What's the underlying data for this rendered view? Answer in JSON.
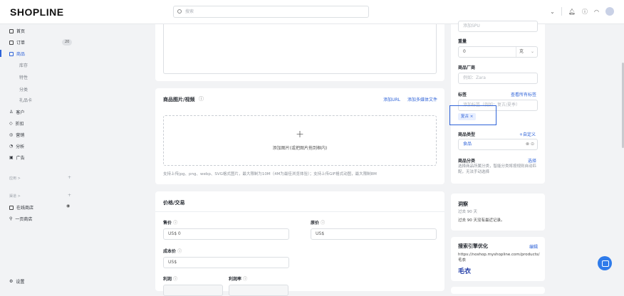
{
  "brand": {
    "logo": "SHOPLINE"
  },
  "search": {
    "placeholder": "搜索"
  },
  "sidebar": {
    "items": [
      {
        "label": "首页"
      },
      {
        "label": "订单",
        "badge": "20"
      },
      {
        "label": "商品"
      },
      {
        "label": "客户"
      },
      {
        "label": "折扣"
      },
      {
        "label": "营销"
      },
      {
        "label": "分析"
      },
      {
        "label": "广告"
      }
    ],
    "subitems": [
      "库存",
      "特性",
      "分类",
      "礼品卡"
    ],
    "apps_label": "应用 >",
    "channels_label": "渠道 >",
    "channels": [
      {
        "label": "在线商店"
      },
      {
        "label": "一页商店"
      }
    ],
    "settings_label": "设置"
  },
  "media": {
    "title": "商品图片/视频",
    "add_url": "添加URL",
    "add_multi": "添加多媒体文件",
    "plus": "+",
    "drop_text": "添加图片(或把图片拖到框内)",
    "hint": "支持上传jpg、png、webp、SVG格式图片，最大限制为10M（4M为最佳浏览体验）；支持上传GIF格式动图，最大限制8M"
  },
  "pricing": {
    "title": "价格/交易",
    "price_label": "售价",
    "price_value": "US$  0",
    "compare_label": "原价",
    "compare_value": "US$",
    "cost_label": "成本价",
    "cost_value": "US$",
    "profit_label": "利润",
    "margin_label": "利润率"
  },
  "right": {
    "spu_placeholder": "添加SPU",
    "weight_label": "重量",
    "weight_value": "0",
    "weight_unit": "克",
    "vendor_label": "商品厂商",
    "vendor_placeholder": "例如：Zara",
    "tags_label": "标签",
    "tags_view_all": "查看所有标签",
    "tags_placeholder": "添加标签（例如：复古/夏季）",
    "tag_chip": "复古",
    "type_label": "商品类型",
    "type_custom": "+自定义",
    "type_value": "食品",
    "category_label": "商品分类",
    "category_select": "选择",
    "category_desc": "选择商品所属分类，智能分类将按规则自动匹配，无法手动选择",
    "insights_title": "洞察",
    "insights_sub": "过去 90 天",
    "insights_desc": "过去 90 天没有最近记录。",
    "seo_title": "搜索引擎优化",
    "seo_edit": "编辑",
    "seo_url": "https://noshop.myshopline.com/products/毛衣",
    "seo_name": "毛衣"
  },
  "colors": {
    "accent": "#2f63d8",
    "chip_bg": "#e8efff"
  }
}
